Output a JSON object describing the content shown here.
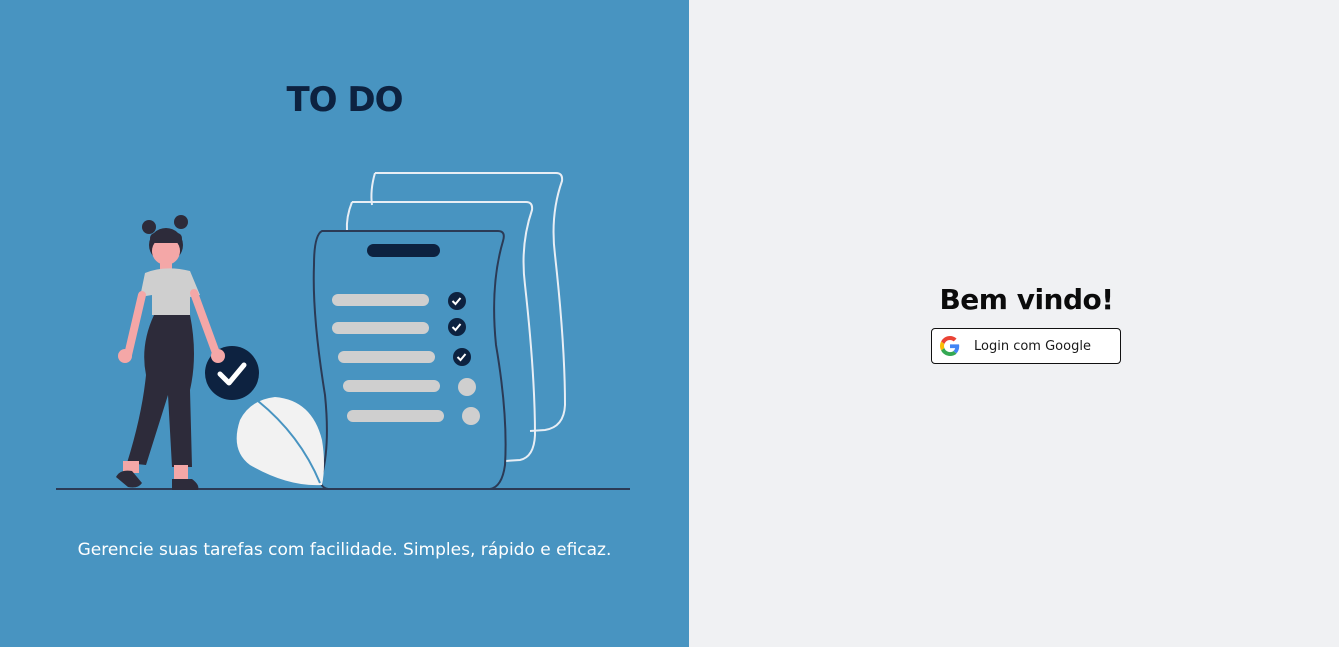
{
  "left_panel": {
    "title": "TO DO",
    "tagline": "Gerencie suas tarefas com facilidade. Simples, rápido e eficaz.",
    "background_color": "#4894c1",
    "illustration_icon": "woman-checklist-illustration"
  },
  "right_panel": {
    "welcome": "Bem vindo!",
    "login_button_label": "Login com Google",
    "login_button_icon": "google-icon",
    "background_color": "#f0f1f3"
  }
}
